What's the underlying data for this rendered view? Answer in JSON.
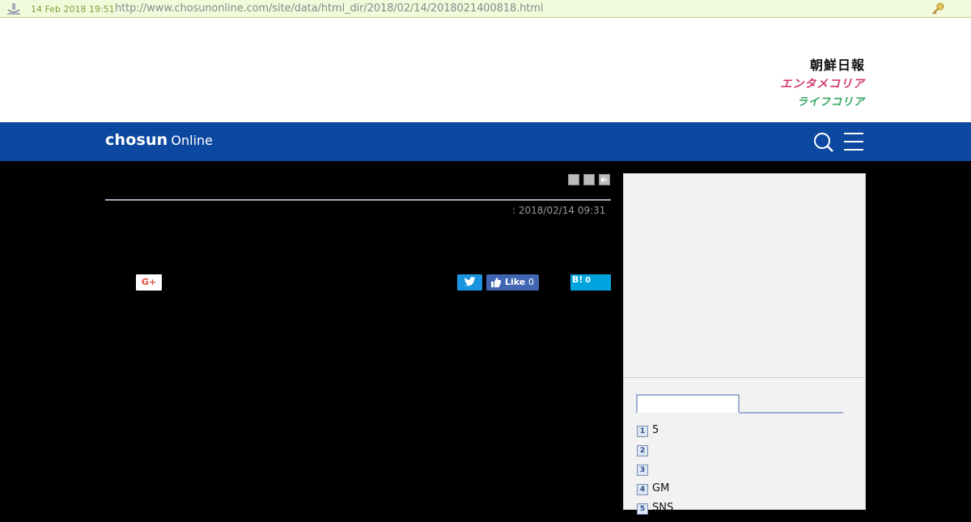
{
  "archive": {
    "date": "14 Feb 2018 19:51",
    "url": "http://www.chosunonline.com/site/data/html_dir/2018/02/14/2018021400818.html"
  },
  "header": {
    "brand_links": [
      "朝鮮日報",
      "エンタメコリア",
      "ライフコリア"
    ]
  },
  "nav": {
    "logo_main": "chosun",
    "logo_sub": "Online"
  },
  "article": {
    "date": ": 2018/02/14 09:31"
  },
  "social": {
    "gplus_label": "G+",
    "fb_like_label": "Like",
    "fb_like_count": "0",
    "hatena_label": "B!",
    "hatena_count": "0"
  },
  "ranking": {
    "items": [
      {
        "num": "1",
        "text": "5"
      },
      {
        "num": "2",
        "text": ""
      },
      {
        "num": "3",
        "text": ""
      },
      {
        "num": "4",
        "text": "GM"
      },
      {
        "num": "5",
        "text": "SNS"
      }
    ]
  },
  "colors": {
    "nav": "#0d48a0",
    "archive_bar": "#f1fadb",
    "entame": "#d2386b",
    "life": "#2fa35b"
  }
}
